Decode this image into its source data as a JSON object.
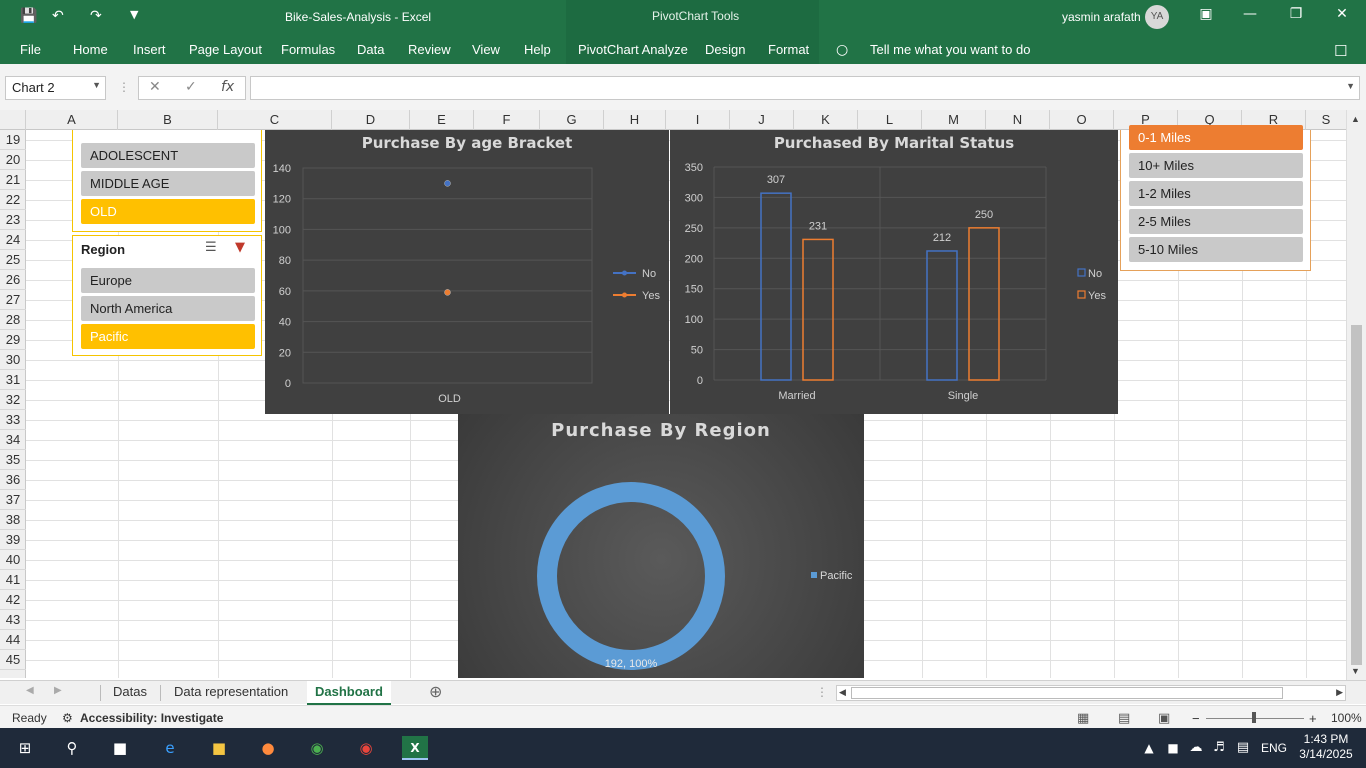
{
  "title_bar": {
    "doc_title": "Bike-Sales-Analysis  -  Excel",
    "context_title": "PivotChart Tools",
    "user_name": "yasmin arafath",
    "user_initials": "YA"
  },
  "ribbon_tabs": [
    "File",
    "Home",
    "Insert",
    "Page Layout",
    "Formulas",
    "Data",
    "Review",
    "View",
    "Help",
    "PivotChart Analyze",
    "Design",
    "Format"
  ],
  "tell_me": "Tell me what you want to do",
  "formula_bar": {
    "name_box": "Chart 2",
    "fx": "fx",
    "value": ""
  },
  "columns": [
    "A",
    "B",
    "C",
    "D",
    "E",
    "F",
    "G",
    "H",
    "I",
    "J",
    "K",
    "L",
    "M",
    "N",
    "O",
    "P",
    "Q",
    "R",
    "S"
  ],
  "rows": [
    "19",
    "20",
    "21",
    "22",
    "23",
    "24",
    "25",
    "26",
    "27",
    "28",
    "29",
    "30",
    "31",
    "32",
    "33",
    "34",
    "35",
    "36",
    "37",
    "38",
    "39",
    "40",
    "41",
    "42",
    "43",
    "44",
    "45"
  ],
  "age_slicer": {
    "items": [
      "ADOLESCENT",
      "MIDDLE AGE",
      "OLD"
    ],
    "selected": "OLD"
  },
  "region_slicer": {
    "title": "Region",
    "items": [
      "Europe",
      "North America",
      "Pacific"
    ],
    "selected": "Pacific"
  },
  "commute_slicer": {
    "items": [
      "0-1 Miles",
      "10+ Miles",
      "1-2 Miles",
      "2-5 Miles",
      "5-10 Miles"
    ],
    "selected": "0-1 Miles"
  },
  "charts": {
    "age": {
      "title": "Purchase By age Bracket"
    },
    "marital": {
      "title": "Purchased By Marital Status"
    },
    "region": {
      "title": "Purchase By Region"
    }
  },
  "chart_data": [
    {
      "type": "line",
      "title": "Purchase By age Bracket",
      "categories": [
        "OLD"
      ],
      "series": [
        {
          "name": "No",
          "values": [
            130
          ]
        },
        {
          "name": "Yes",
          "values": [
            59
          ]
        }
      ],
      "ylim": [
        0,
        140
      ],
      "yticks": [
        0,
        20,
        40,
        60,
        80,
        100,
        120,
        140
      ],
      "colors": [
        "#4472c4",
        "#ed7d31"
      ],
      "legend": "right",
      "grid": true
    },
    {
      "type": "bar",
      "title": "Purchased By Marital Status",
      "categories": [
        "Married",
        "Single"
      ],
      "series": [
        {
          "name": "No",
          "values": [
            307,
            212
          ]
        },
        {
          "name": "Yes",
          "values": [
            231,
            250
          ]
        }
      ],
      "ylim": [
        0,
        350
      ],
      "yticks": [
        0,
        50,
        100,
        150,
        200,
        250,
        300,
        350
      ],
      "colors": [
        "#4472c4",
        "#ed7d31"
      ],
      "legend": "right",
      "grid": true
    },
    {
      "type": "pie",
      "title": "Purchase By Region",
      "categories": [
        "Pacific"
      ],
      "values": [
        192
      ],
      "data_label": "192, 100%",
      "colors": [
        "#5b9bd5"
      ],
      "legend": "right"
    }
  ],
  "sheet_tabs": [
    "Datas",
    "Data representation",
    "Dashboard"
  ],
  "active_sheet": "Dashboard",
  "status": {
    "ready": "Ready",
    "accessibility": "Accessibility: Investigate",
    "zoom": "100%"
  },
  "taskbar": {
    "time": "1:43 PM",
    "date": "3/14/2025",
    "lang": "ENG"
  }
}
